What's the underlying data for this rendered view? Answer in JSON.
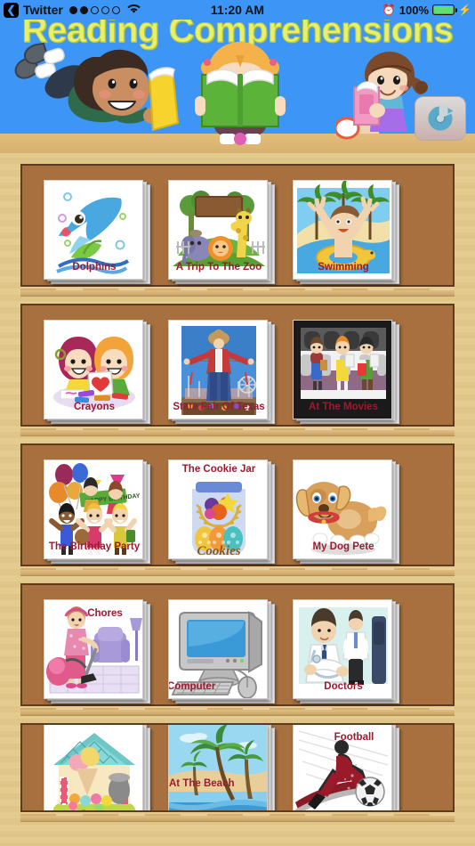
{
  "status_bar": {
    "back_label": "Twitter",
    "back_icon": "chevron-left-icon",
    "signal_dots_filled": 2,
    "signal_dots_total": 5,
    "wifi_icon": "wifi-icon",
    "time": "11:20 AM",
    "alarm_icon": "alarm-clock-icon",
    "battery_percent": "100%",
    "battery_level": 100,
    "charging_icon": "lightning-bolt-icon",
    "bar_color": "#3d96f5"
  },
  "banner": {
    "title": "Reading Comprehensions",
    "title_color": "#e8f06a",
    "background_color": "#3d96f5",
    "refresh_button_label": "refresh-icon",
    "illustrations": [
      "boy-reading-yellow-book",
      "girl-reading-green-book",
      "girl-reading-pink-book"
    ]
  },
  "shelf": {
    "frame_color": "#e3c98a",
    "panel_color": "#a8703f",
    "label_color": "#9B1B30",
    "rows": [
      {
        "items": [
          {
            "title": "Dolphins",
            "art": "dolphin",
            "label_pos": "bottom"
          },
          {
            "title": "A Trip To The Zoo",
            "art": "zoo",
            "label_pos": "bottom"
          },
          {
            "title": "Swimming",
            "art": "swimming",
            "label_pos": "bottom"
          }
        ]
      },
      {
        "items": [
          {
            "title": "Crayons",
            "art": "crayons",
            "label_pos": "bottom"
          },
          {
            "title": "State Fair Of Texas",
            "art": "statefair",
            "label_pos": "bottom"
          },
          {
            "title": "At The Movies",
            "art": "movies",
            "label_pos": "bottom"
          }
        ]
      },
      {
        "items": [
          {
            "title": "The Birthday Party",
            "art": "birthday",
            "label_pos": "bottom"
          },
          {
            "title": "The Cookie Jar",
            "art": "cookiejar",
            "label_pos": "top"
          },
          {
            "title": "My Dog Pete",
            "art": "dog",
            "label_pos": "bottom"
          }
        ]
      },
      {
        "items": [
          {
            "title": "Chores",
            "art": "chores",
            "label_pos": "topright"
          },
          {
            "title": "Computer",
            "art": "computer",
            "label_pos": "bottomleft"
          },
          {
            "title": "Doctors",
            "art": "doctors",
            "label_pos": "bottom"
          }
        ]
      },
      {
        "items": [
          {
            "title": "",
            "art": "icecream",
            "label_pos": "bottom"
          },
          {
            "title": "At The Beach",
            "art": "beach",
            "label_pos": "mid"
          },
          {
            "title": "Football",
            "art": "football",
            "label_pos": "topright"
          }
        ]
      }
    ]
  }
}
